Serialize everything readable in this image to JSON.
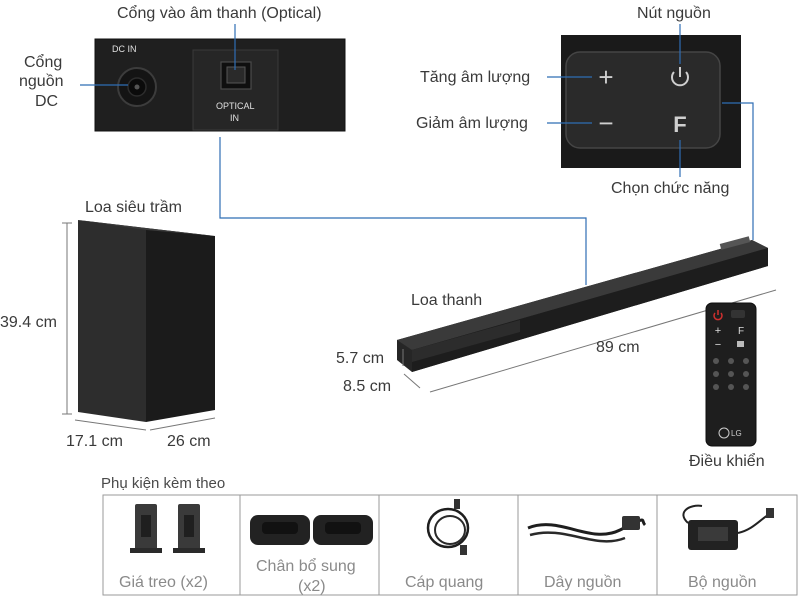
{
  "callouts": {
    "optical": "Cổng vào âm thanh (Optical)",
    "dc_line1": "Cổng",
    "dc_line2": "nguồn",
    "dc_line3": "DC",
    "power": "Nút nguồn",
    "vol_up": "Tăng âm lượng",
    "vol_down": "Giảm âm lượng",
    "function": "Chọn chức năng",
    "subwoofer": "Loa siêu trầm",
    "soundbar": "Loa thanh",
    "remote": "Điều khiển"
  },
  "panel": {
    "optical_line1": "OPTICAL",
    "optical_line2": "IN",
    "dc_badge": "DC IN"
  },
  "buttons": {
    "plus": "+",
    "minus": "−",
    "f": "F"
  },
  "dimensions": {
    "sub_height": "39.4 cm",
    "sub_width": "17.1 cm",
    "sub_depth": "26 cm",
    "bar_height": "5.7 cm",
    "bar_depth": "8.5 cm",
    "bar_width": "89 cm"
  },
  "remote_text": {
    "brand": "LG"
  },
  "accessories": {
    "title": "Phụ kiện kèm theo",
    "items": [
      {
        "label": "Giá treo (x2)",
        "label2": ""
      },
      {
        "label": "Chân bổ sung",
        "label2": "(x2)"
      },
      {
        "label": "Cáp quang",
        "label2": ""
      },
      {
        "label": "Dây nguồn",
        "label2": ""
      },
      {
        "label": "Bộ nguồn",
        "label2": ""
      }
    ]
  },
  "colors": {
    "device": "#2a2a2a",
    "device_dark": "#1c1c1c",
    "leader": "#2f6db5",
    "accent_red": "#d0302f"
  }
}
